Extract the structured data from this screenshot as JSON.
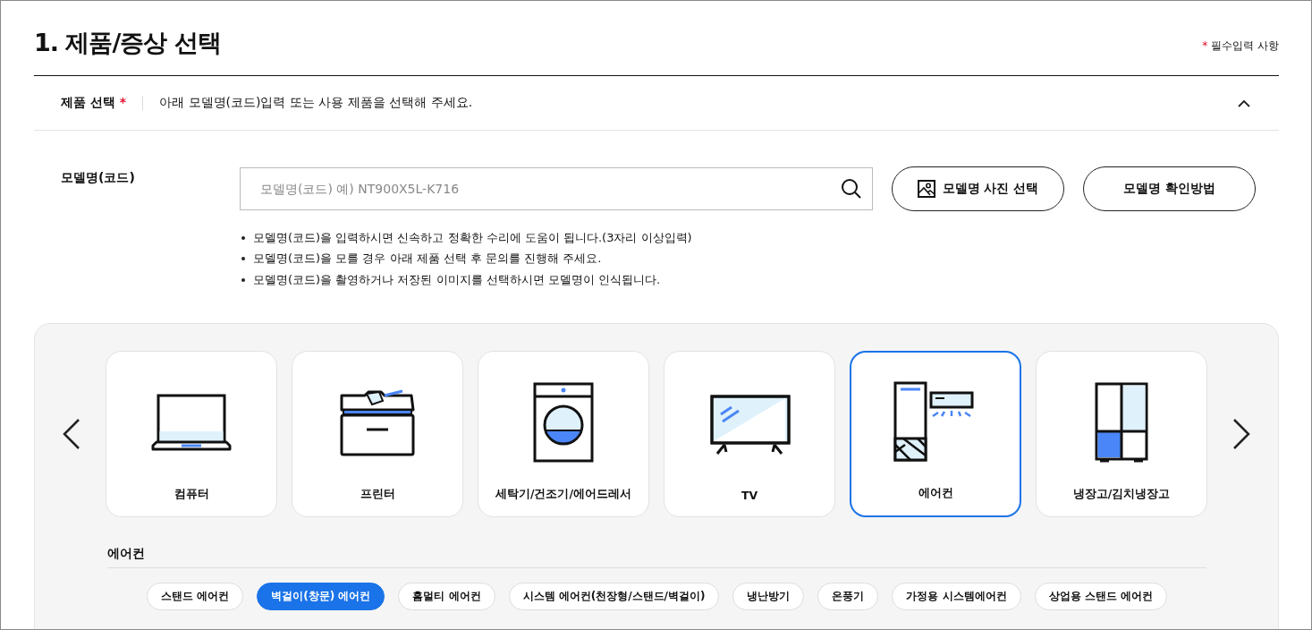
{
  "title": "1. 제품/증상 선택",
  "required_note": {
    "mark": "*",
    "text": "필수입력 사항"
  },
  "product_section": {
    "label": "제품 선택",
    "required_mark": "*",
    "description": "아래 모델명(코드)입력 또는 사용 제품을 선택해 주세요.",
    "expanded": true
  },
  "model": {
    "label": "모델명(코드)",
    "placeholder": "모델명(코드) 예) NT900X5L-K716",
    "buttons": [
      {
        "label": "모델명 사진 선택",
        "kind": "photo"
      },
      {
        "label": "모델명 확인방법",
        "kind": "plain"
      }
    ],
    "notes": [
      "모델명(코드)을 입력하시면 신속하고 정확한 수리에 도움이 됩니다.(3자리 이상입력)",
      "모델명(코드)을 모를 경우 아래 제품 선택 후 문의를 진행해 주세요.",
      "모델명(코드)을 촬영하거나 저장된 이미지를 선택하시면 모델명이 인식됩니다."
    ]
  },
  "categories": [
    {
      "label": "컴퓨터",
      "kind": "laptop",
      "selected": false
    },
    {
      "label": "프린터",
      "kind": "printer",
      "selected": false
    },
    {
      "label": "세탁기/건조기/에어드레서",
      "kind": "washer",
      "selected": false
    },
    {
      "label": "TV",
      "kind": "tv",
      "selected": false
    },
    {
      "label": "에어컨",
      "kind": "aircon",
      "selected": true
    },
    {
      "label": "냉장고/김치냉장고",
      "kind": "fridge",
      "selected": false
    }
  ],
  "subcategory": {
    "title": "에어컨",
    "items": [
      {
        "label": "스탠드 에어컨",
        "selected": false
      },
      {
        "label": "벽걸이(창문) 에어컨",
        "selected": true
      },
      {
        "label": "홈멀티 에어컨",
        "selected": false
      },
      {
        "label": "시스템 에어컨(천장형/스탠드/벽걸이)",
        "selected": false
      },
      {
        "label": "냉난방기",
        "selected": false
      },
      {
        "label": "온풍기",
        "selected": false
      },
      {
        "label": "가정용 시스템에어컨",
        "selected": false
      },
      {
        "label": "상업용 스탠드 에어컨",
        "selected": false
      }
    ]
  }
}
